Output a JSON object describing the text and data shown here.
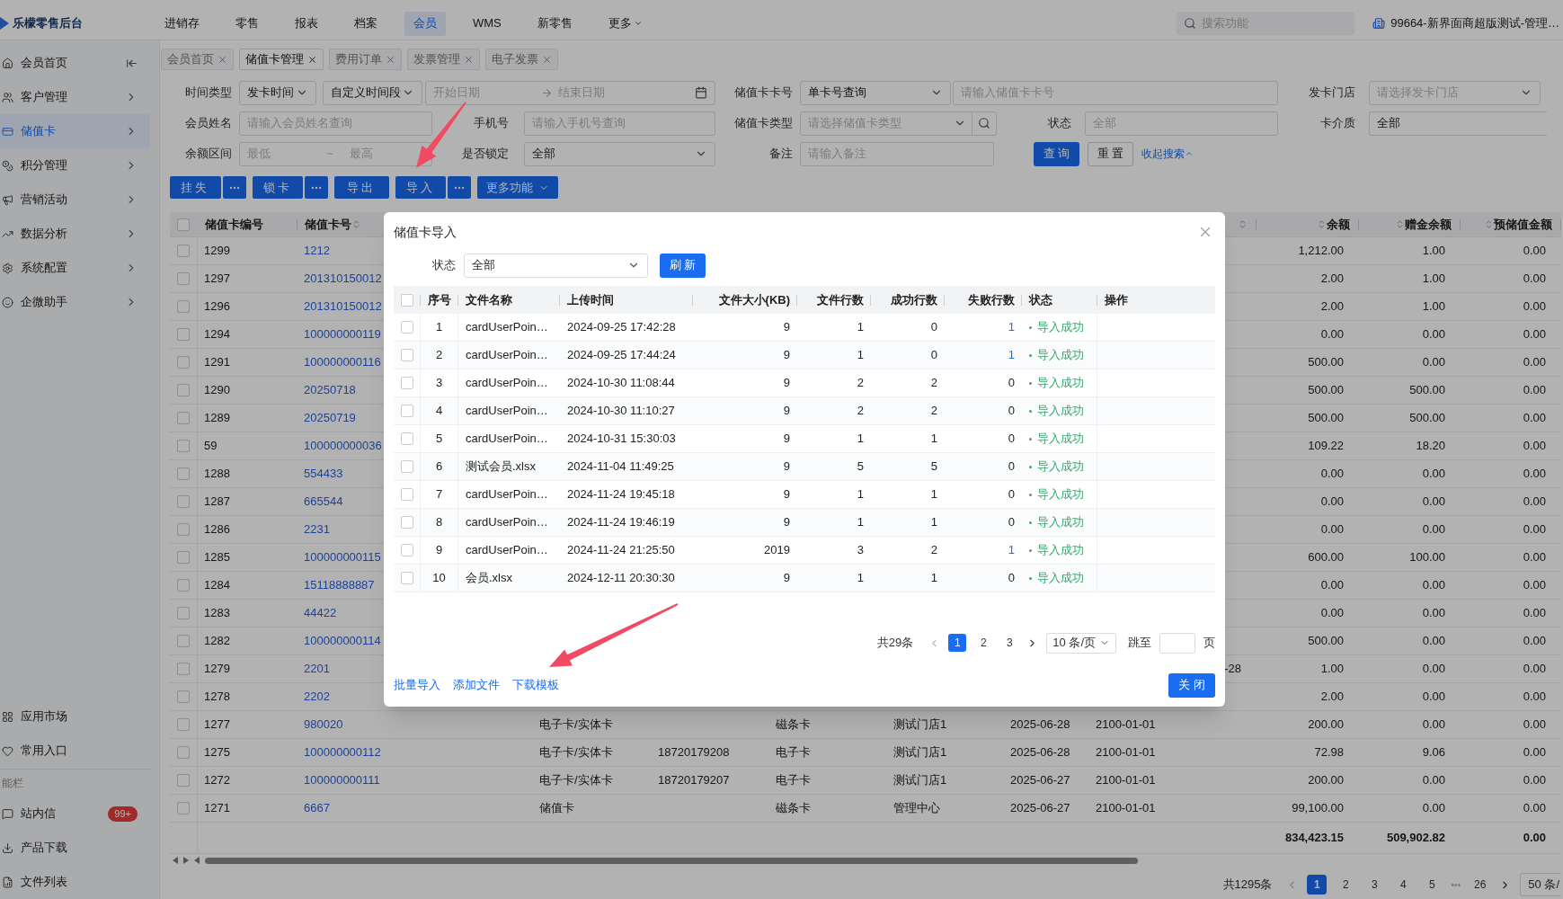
{
  "app": {
    "logo_text": "乐檬零售后台"
  },
  "top_nav": [
    {
      "label": "进销存",
      "selected": false,
      "has_menu": false
    },
    {
      "label": "零售",
      "selected": false,
      "has_menu": false
    },
    {
      "label": "报表",
      "selected": false,
      "has_menu": false
    },
    {
      "label": "档案",
      "selected": false,
      "has_menu": false
    },
    {
      "label": "会员",
      "selected": true,
      "has_menu": false
    },
    {
      "label": "WMS",
      "selected": false,
      "has_menu": false
    },
    {
      "label": "新零售",
      "selected": false,
      "has_menu": false
    },
    {
      "label": "更多",
      "selected": false,
      "has_menu": true
    }
  ],
  "search": {
    "placeholder": "搜索功能"
  },
  "store": "99664-新界面商超版测试-管理…",
  "sidebar": {
    "items": [
      {
        "label": "会员首页",
        "selected": false
      },
      {
        "label": "客户管理",
        "selected": false
      },
      {
        "label": "储值卡",
        "selected": true
      },
      {
        "label": "积分管理",
        "selected": false
      },
      {
        "label": "营销活动",
        "selected": false
      },
      {
        "label": "数据分析",
        "selected": false
      },
      {
        "label": "系统配置",
        "selected": false
      },
      {
        "label": "企微助手",
        "selected": false
      }
    ],
    "bottom_items": [
      {
        "label": "应用市场"
      },
      {
        "label": "常用入口"
      }
    ],
    "function_bar": {
      "title": "能栏",
      "items": [
        {
          "label": "站内信",
          "badge": "99+"
        },
        {
          "label": "产品下载"
        },
        {
          "label": "文件列表"
        }
      ]
    }
  },
  "tabs": [
    {
      "label": "会员首页",
      "selected": false
    },
    {
      "label": "储值卡管理",
      "selected": true
    },
    {
      "label": "费用订单",
      "selected": false
    },
    {
      "label": "发票管理",
      "selected": false
    },
    {
      "label": "电子发票",
      "selected": false
    }
  ],
  "filters": {
    "time_type": {
      "label": "时间类型",
      "value": "发卡时间"
    },
    "time_range": {
      "value": "自定义时间段"
    },
    "start_date": {
      "placeholder": "开始日期"
    },
    "end_date": {
      "placeholder": "结束日期"
    },
    "card_no": {
      "label": "储值卡卡号",
      "mode": "单卡号查询",
      "placeholder": "请输入储值卡卡号"
    },
    "store": {
      "label": "发卡门店",
      "placeholder": "请选择发卡门店"
    },
    "member_name": {
      "label": "会员姓名",
      "placeholder": "请输入会员姓名查询"
    },
    "phone": {
      "label": "手机号",
      "placeholder": "请输入手机号查询"
    },
    "card_type": {
      "label": "储值卡类型",
      "placeholder": "请选择储值卡类型"
    },
    "status": {
      "label": "状态",
      "placeholder": "全部"
    },
    "medium": {
      "label": "卡介质",
      "value": "全部"
    },
    "balance_range": {
      "label": "余额区间",
      "min_placeholder": "最低",
      "separator": "~",
      "max_placeholder": "最高"
    },
    "locked": {
      "label": "是否锁定",
      "value": "全部"
    },
    "remark": {
      "label": "备注",
      "placeholder": "请输入备注"
    },
    "query_button": "查询",
    "reset_button": "重置",
    "collapse_link": "收起搜索"
  },
  "actions": [
    {
      "label": "挂失",
      "kind": "split"
    },
    {
      "label": "锁卡",
      "kind": "split"
    },
    {
      "label": "导出",
      "kind": "plain"
    },
    {
      "label": "导入",
      "kind": "split"
    },
    {
      "label": "更多功能",
      "kind": "dropdown"
    }
  ],
  "table": {
    "all_checked": false,
    "columns": {
      "id": "储值卡编号",
      "card_no": "储值卡号",
      "balance": "余额",
      "bonus": "赠金余额",
      "prestored": "预储值金额"
    },
    "rows": [
      {
        "checked": false,
        "id": "1299",
        "card_no": "1212",
        "balance": "1,212.00",
        "bonus": "1.00",
        "prestored": "0.00"
      },
      {
        "checked": false,
        "id": "1297",
        "card_no": "201310150012",
        "balance": "2.00",
        "bonus": "1.00",
        "prestored": "0.00"
      },
      {
        "checked": false,
        "id": "1296",
        "card_no": "201310150012",
        "balance": "2.00",
        "bonus": "1.00",
        "prestored": "0.00"
      },
      {
        "checked": false,
        "id": "1294",
        "card_no": "100000000119",
        "balance": "0.00",
        "bonus": "0.00",
        "prestored": "0.00"
      },
      {
        "checked": false,
        "id": "1291",
        "card_no": "100000000116",
        "balance": "500.00",
        "bonus": "0.00",
        "prestored": "0.00"
      },
      {
        "checked": false,
        "id": "1290",
        "card_no": "20250718",
        "balance": "500.00",
        "bonus": "500.00",
        "prestored": "0.00"
      },
      {
        "checked": false,
        "id": "1289",
        "card_no": "20250719",
        "balance": "500.00",
        "bonus": "500.00",
        "prestored": "0.00"
      },
      {
        "checked": false,
        "id": "59",
        "card_no": "100000000036",
        "balance": "109.22",
        "bonus": "18.20",
        "prestored": "0.00"
      },
      {
        "checked": false,
        "id": "1288",
        "card_no": "554433",
        "balance": "0.00",
        "bonus": "0.00",
        "prestored": "0.00"
      },
      {
        "checked": false,
        "id": "1287",
        "card_no": "665544",
        "balance": "0.00",
        "bonus": "0.00",
        "prestored": "0.00"
      },
      {
        "checked": false,
        "id": "1286",
        "card_no": "2231",
        "balance": "0.00",
        "bonus": "0.00",
        "prestored": "0.00"
      },
      {
        "checked": false,
        "id": "1285",
        "card_no": "100000000115",
        "balance": "600.00",
        "bonus": "100.00",
        "prestored": "0.00"
      },
      {
        "checked": false,
        "id": "1284",
        "card_no": "15118888887",
        "balance": "0.00",
        "bonus": "0.00",
        "prestored": "0.00"
      },
      {
        "checked": false,
        "id": "1283",
        "card_no": "44422",
        "balance": "0.00",
        "bonus": "0.00",
        "prestored": "0.00"
      },
      {
        "checked": false,
        "id": "1282",
        "card_no": "100000000114",
        "balance": "500.00",
        "bonus": "0.00",
        "prestored": "0.00"
      },
      {
        "checked": false,
        "id": "1279",
        "card_no": "2201",
        "column_10": "-28",
        "balance": "1.00",
        "bonus": "0.00",
        "prestored": "0.00"
      },
      {
        "checked": false,
        "id": "1278",
        "card_no": "2202",
        "balance": "2.00",
        "bonus": "0.00",
        "prestored": "0.00"
      },
      {
        "checked": false,
        "id": "1277",
        "card_no": "980020",
        "card_type": "电子卡/实体卡",
        "medium": "磁条卡",
        "store": "测试门店1",
        "issue_date": "2025-06-28",
        "expiry": "2100-01-01",
        "balance": "200.00",
        "bonus": "0.00",
        "prestored": "0.00"
      },
      {
        "checked": false,
        "id": "1275",
        "card_no": "100000000112",
        "card_type": "电子卡/实体卡",
        "phone": "18720179208",
        "medium": "电子卡",
        "store": "测试门店1",
        "issue_date": "2025-06-28",
        "expiry": "2100-01-01",
        "balance": "72.98",
        "bonus": "9.06",
        "prestored": "0.00"
      },
      {
        "checked": false,
        "id": "1272",
        "card_no": "100000000111",
        "card_type": "电子卡/实体卡",
        "phone": "18720179207",
        "medium": "电子卡",
        "store": "测试门店1",
        "issue_date": "2025-06-27",
        "expiry": "2100-01-01",
        "balance": "200.00",
        "bonus": "0.00",
        "prestored": "0.00"
      },
      {
        "checked": false,
        "id": "1271",
        "card_no": "6667",
        "card_type": "储值卡",
        "medium": "磁条卡",
        "store": "管理中心",
        "issue_date": "2025-06-27",
        "expiry": "2100-01-01",
        "balance": "99,100.00",
        "bonus": "0.00",
        "prestored": "0.00"
      }
    ],
    "totals": {
      "balance": "834,423.15",
      "bonus": "509,902.82",
      "prestored": "0.00"
    }
  },
  "pagination": {
    "total": "共1295条",
    "pages": [
      {
        "kind": "page",
        "label": "1",
        "selected": true
      },
      {
        "kind": "page",
        "label": "2",
        "selected": false
      },
      {
        "kind": "page",
        "label": "3",
        "selected": false
      },
      {
        "kind": "page",
        "label": "4",
        "selected": false
      },
      {
        "kind": "page",
        "label": "5",
        "selected": false
      },
      {
        "kind": "ellipsis",
        "label": "•••"
      },
      {
        "kind": "page",
        "label": "26",
        "selected": false
      }
    ],
    "page_size": "50 条/"
  },
  "modal": {
    "title": "储值卡导入",
    "status_filter": {
      "label": "状态",
      "value": "全部"
    },
    "refresh_button": "刷新",
    "all_checked": false,
    "columns": [
      "序号",
      "文件名称",
      "上传时间",
      "文件大小(KB)",
      "文件行数",
      "成功行数",
      "失败行数",
      "状态",
      "操作"
    ],
    "rows": [
      {
        "checked": false,
        "index": "1",
        "file_name": "cardUserPoin…",
        "uploaded": "2024-09-25 17:42:28",
        "size": "9",
        "lines": "1",
        "succeeded": "0",
        "failed": "1",
        "failed_link": true,
        "status": "导入成功"
      },
      {
        "checked": false,
        "index": "2",
        "file_name": "cardUserPoin…",
        "uploaded": "2024-09-25 17:44:24",
        "size": "9",
        "lines": "1",
        "succeeded": "0",
        "failed": "1",
        "failed_link": true,
        "status": "导入成功"
      },
      {
        "checked": false,
        "index": "3",
        "file_name": "cardUserPoin…",
        "uploaded": "2024-10-30 11:08:44",
        "size": "9",
        "lines": "2",
        "succeeded": "2",
        "failed": "0",
        "failed_link": false,
        "status": "导入成功"
      },
      {
        "checked": false,
        "index": "4",
        "file_name": "cardUserPoin…",
        "uploaded": "2024-10-30 11:10:27",
        "size": "9",
        "lines": "2",
        "succeeded": "2",
        "failed": "0",
        "failed_link": false,
        "status": "导入成功"
      },
      {
        "checked": false,
        "index": "5",
        "file_name": "cardUserPoin…",
        "uploaded": "2024-10-31 15:30:03",
        "size": "9",
        "lines": "1",
        "succeeded": "1",
        "failed": "0",
        "failed_link": false,
        "status": "导入成功"
      },
      {
        "checked": false,
        "index": "6",
        "file_name": "测试会员.xlsx",
        "uploaded": "2024-11-04 11:49:25",
        "size": "9",
        "lines": "5",
        "succeeded": "5",
        "failed": "0",
        "failed_link": false,
        "status": "导入成功"
      },
      {
        "checked": false,
        "index": "7",
        "file_name": "cardUserPoin…",
        "uploaded": "2024-11-24 19:45:18",
        "size": "9",
        "lines": "1",
        "succeeded": "1",
        "failed": "0",
        "failed_link": false,
        "status": "导入成功"
      },
      {
        "checked": false,
        "index": "8",
        "file_name": "cardUserPoin…",
        "uploaded": "2024-11-24 19:46:19",
        "size": "9",
        "lines": "1",
        "succeeded": "1",
        "failed": "0",
        "failed_link": false,
        "status": "导入成功"
      },
      {
        "checked": false,
        "index": "9",
        "file_name": "cardUserPoin…",
        "uploaded": "2024-11-24 21:25:50",
        "size": "2019",
        "lines": "3",
        "succeeded": "2",
        "failed": "1",
        "failed_link": true,
        "status": "导入成功"
      },
      {
        "checked": false,
        "index": "10",
        "file_name": "会员.xlsx",
        "uploaded": "2024-12-11 20:30:30",
        "size": "9",
        "lines": "1",
        "succeeded": "1",
        "failed": "0",
        "failed_link": false,
        "status": "导入成功"
      }
    ],
    "pagination": {
      "total": "共29条",
      "pages": [
        {
          "label": "1",
          "selected": true
        },
        {
          "label": "2",
          "selected": false
        },
        {
          "label": "3",
          "selected": false
        }
      ],
      "page_size": "10 条/页",
      "jump_label": "跳至",
      "page_unit": "页"
    },
    "footer_links": [
      "批量导入",
      "添加文件",
      "下载模板"
    ],
    "close_button": "关闭"
  }
}
